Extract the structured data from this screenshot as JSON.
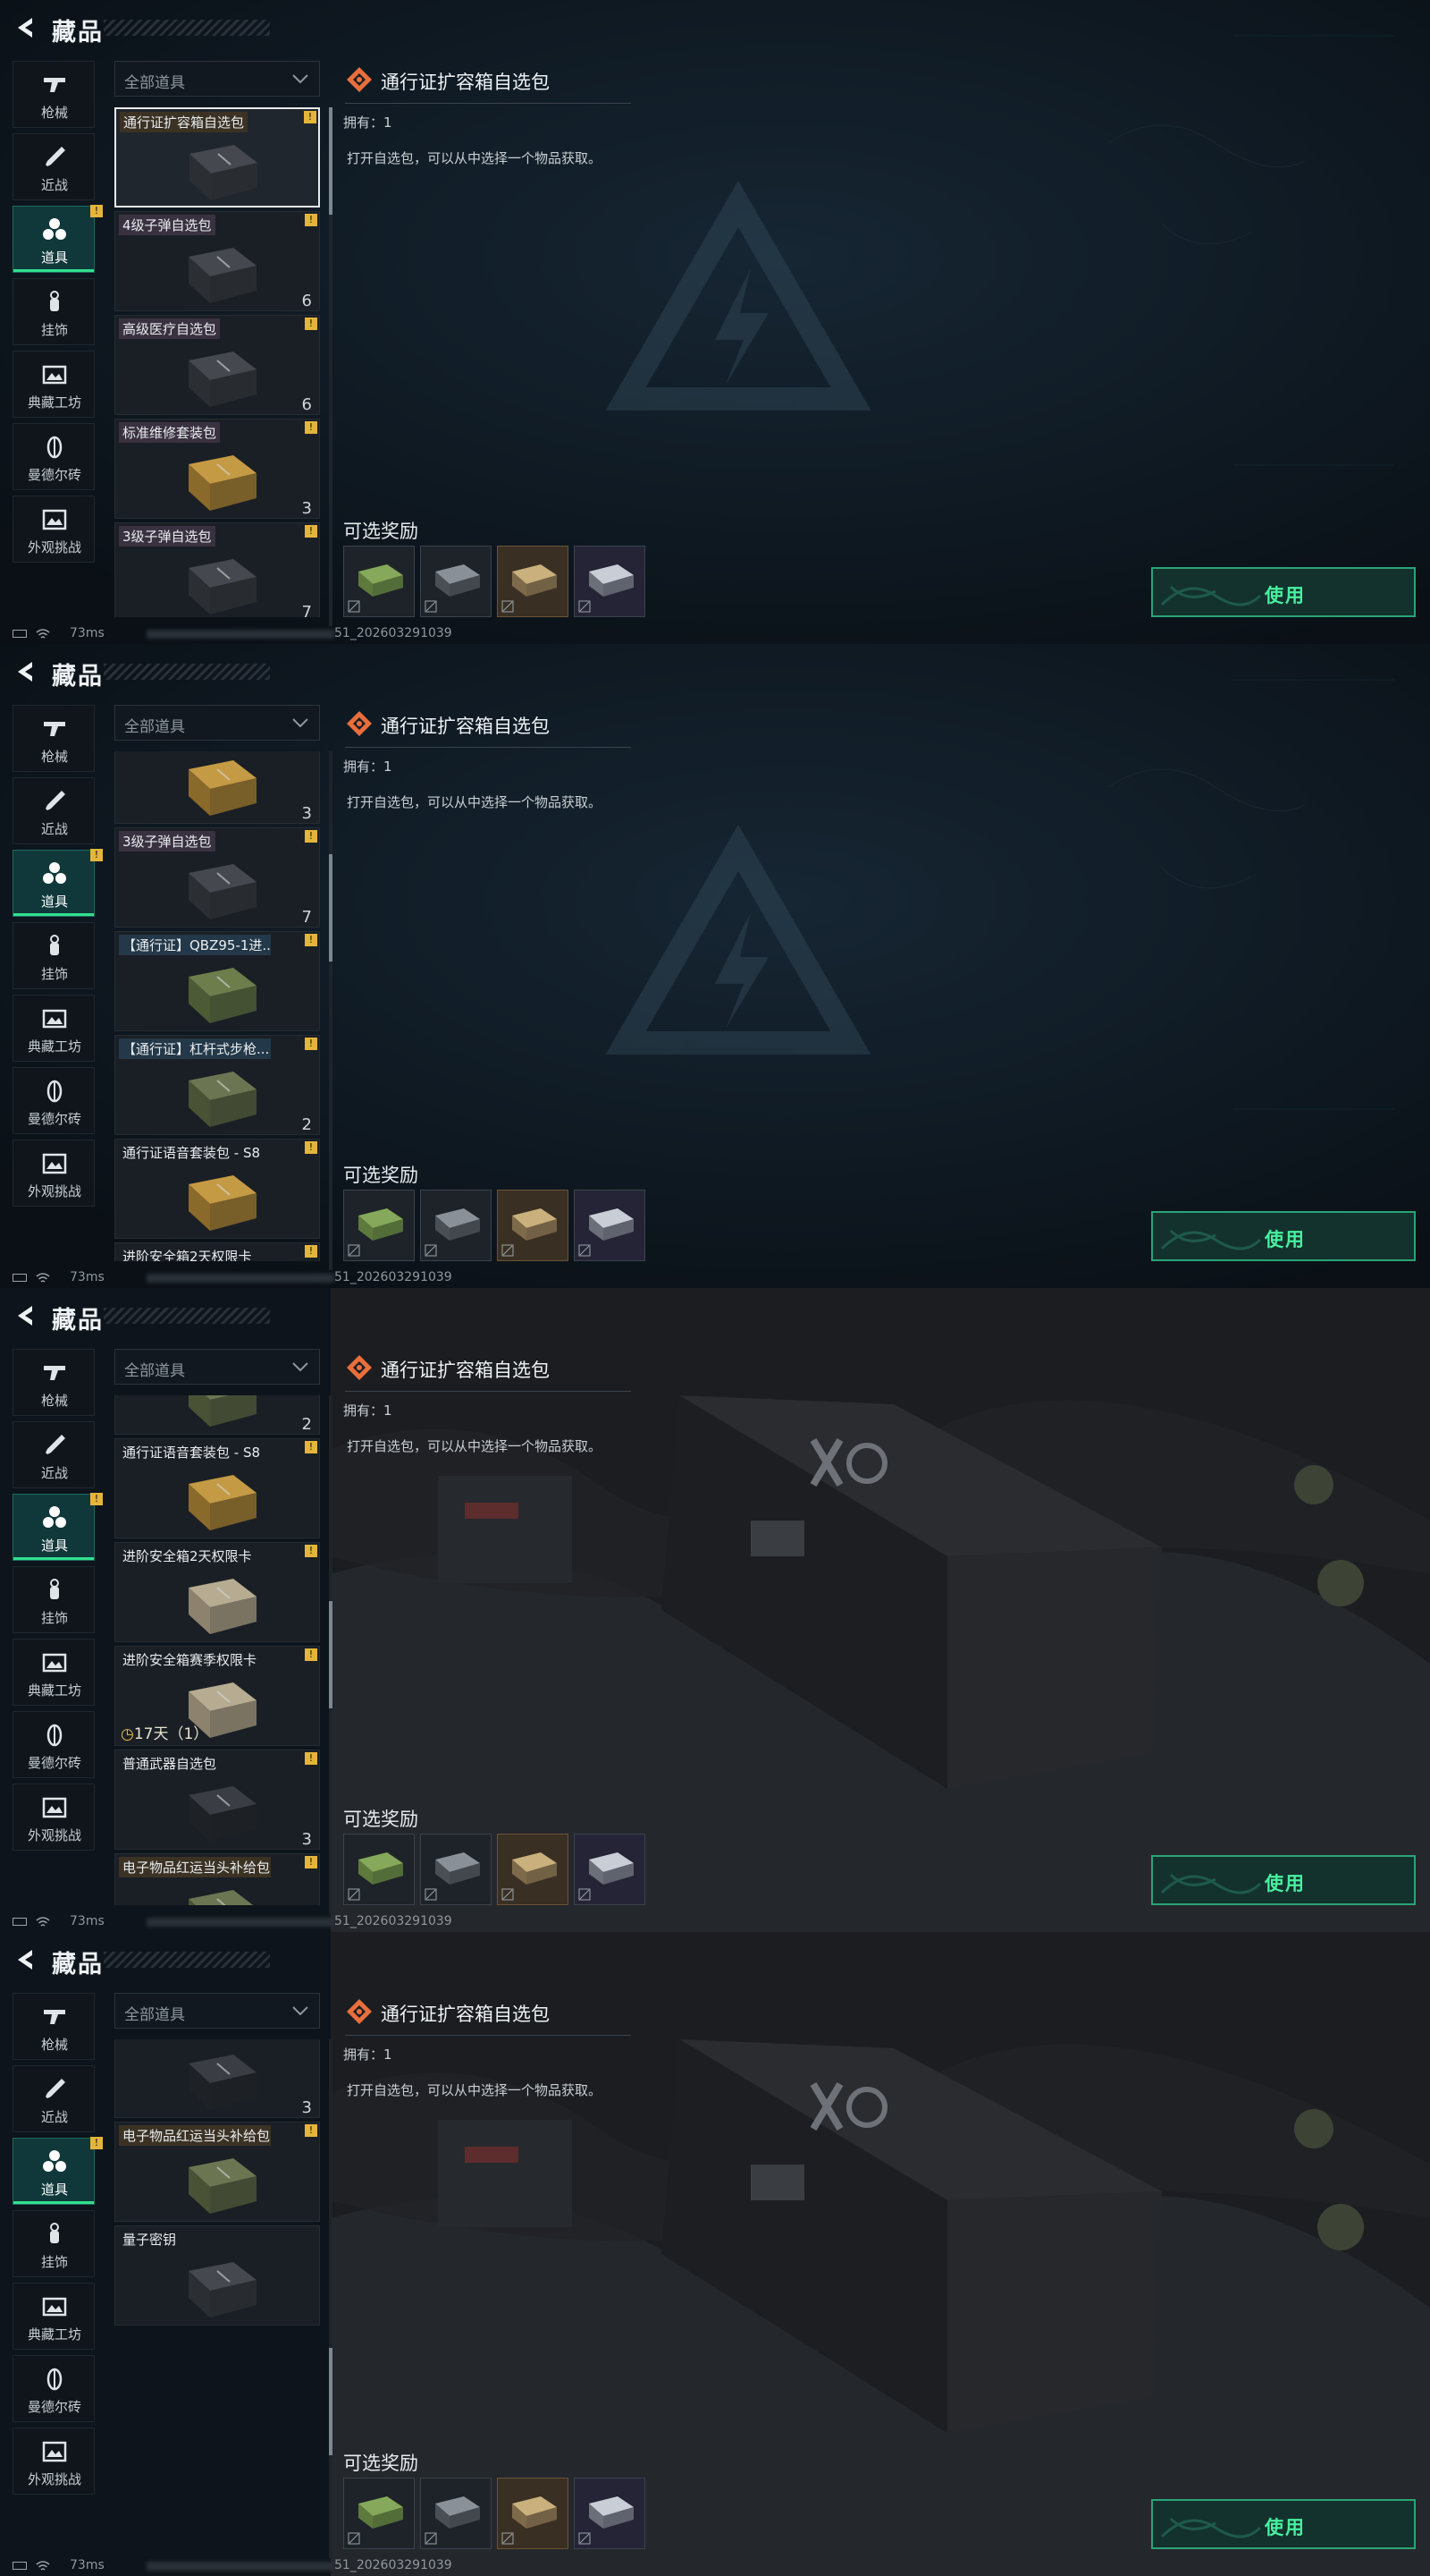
{
  "colors": {
    "accent": "#33e08f",
    "badge": "#e5b53a",
    "selected_border": "#e8eaeb",
    "use_button_text": "#48f0a0"
  },
  "header": {
    "title": "藏品",
    "back_icon": "back-arrow-icon"
  },
  "sidebar": {
    "items": [
      {
        "label": "枪械",
        "icon": "gun-icon"
      },
      {
        "label": "近战",
        "icon": "knife-icon"
      },
      {
        "label": "道具",
        "icon": "props-icon",
        "active": true,
        "badge": "!"
      },
      {
        "label": "挂饰",
        "icon": "charm-icon"
      },
      {
        "label": "典藏工坊",
        "icon": "workshop-icon"
      },
      {
        "label": "曼德尔砖",
        "icon": "brick-icon"
      },
      {
        "label": "外观挑战",
        "icon": "challenge-icon"
      }
    ]
  },
  "filter": {
    "selected": "全部道具"
  },
  "items": {
    "pass_box": {
      "name": "通行证扩容箱自选包",
      "badge": "!"
    },
    "ammo4": {
      "name": "4级子弹自选包",
      "count": "6",
      "badge": "!"
    },
    "medical": {
      "name": "高级医疗自选包",
      "count": "6",
      "badge": "!"
    },
    "repair": {
      "name": "标准维修套装包",
      "count": "3",
      "badge": "!"
    },
    "ammo3": {
      "name": "3级子弹自选包",
      "count": "7",
      "badge": "!"
    },
    "qbz": {
      "name": "【通行证】QBZ95-1进...",
      "badge": "!"
    },
    "lever": {
      "name": "【通行证】杠杆式步枪...",
      "count": "2",
      "badge": "!"
    },
    "voice": {
      "name": "通行证语音套装包 - S8",
      "badge": "!"
    },
    "safe2d": {
      "name": "进阶安全箱2天权限卡",
      "badge": "!"
    },
    "safe_season": {
      "name": "进阶安全箱赛季权限卡",
      "badge": "!",
      "timer": "17天（1）"
    },
    "weapon": {
      "name": "普通武器自选包",
      "count": "3",
      "badge": "!"
    },
    "electronic": {
      "name": "电子物品红运当头补给包",
      "badge": "!"
    },
    "quantum": {
      "name": "量子密钥"
    },
    "top_count": "6"
  },
  "detail": {
    "icon": "diamond-icon",
    "title": "通行证扩容箱自选包",
    "owned": "拥有：1",
    "description": "打开自选包，可以从中选择一个物品获取。",
    "rewards_label": "可选奖励",
    "rewards": [
      "green-box-icon",
      "grey-box-icon",
      "gold-box-icon",
      "white-box-icon"
    ],
    "use_button": "使用"
  },
  "status": {
    "ping": "73ms",
    "id": "51_202603291039"
  },
  "scroll": {
    "panel1": 0.0,
    "panel2": 0.25,
    "panel3": 0.5,
    "panel4": 0.75
  }
}
